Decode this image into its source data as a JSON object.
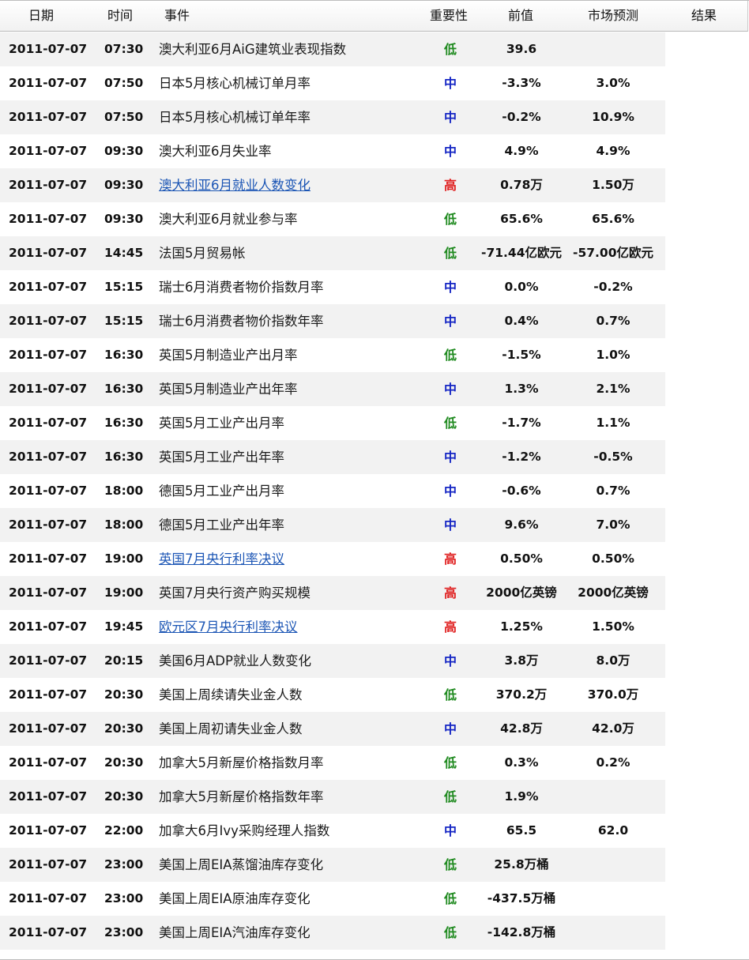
{
  "columns": [
    "日期",
    "时间",
    "事件",
    "重要性",
    "前值",
    "市场预测",
    "结果"
  ],
  "importance_colors": {
    "低": "#1f8a1f",
    "中": "#1526c4",
    "高": "#e02020"
  },
  "link_color": "#1c56b5",
  "rows": [
    {
      "date": "2011-07-07",
      "time": "07:30",
      "event": "澳大利亚6月AiG建筑业表现指数",
      "link": false,
      "importance": "低",
      "previous": "39.6",
      "forecast": "",
      "result": ""
    },
    {
      "date": "2011-07-07",
      "time": "07:50",
      "event": "日本5月核心机械订单月率",
      "link": false,
      "importance": "中",
      "previous": "-3.3%",
      "forecast": "3.0%",
      "result": ""
    },
    {
      "date": "2011-07-07",
      "time": "07:50",
      "event": "日本5月核心机械订单年率",
      "link": false,
      "importance": "中",
      "previous": "-0.2%",
      "forecast": "10.9%",
      "result": ""
    },
    {
      "date": "2011-07-07",
      "time": "09:30",
      "event": "澳大利亚6月失业率",
      "link": false,
      "importance": "中",
      "previous": "4.9%",
      "forecast": "4.9%",
      "result": ""
    },
    {
      "date": "2011-07-07",
      "time": "09:30",
      "event": "澳大利亚6月就业人数变化",
      "link": true,
      "importance": "高",
      "previous": "0.78万",
      "forecast": "1.50万",
      "result": ""
    },
    {
      "date": "2011-07-07",
      "time": "09:30",
      "event": "澳大利亚6月就业参与率",
      "link": false,
      "importance": "低",
      "previous": "65.6%",
      "forecast": "65.6%",
      "result": ""
    },
    {
      "date": "2011-07-07",
      "time": "14:45",
      "event": "法国5月贸易帐",
      "link": false,
      "importance": "低",
      "previous": "-71.44亿欧元",
      "forecast": "-57.00亿欧元",
      "result": ""
    },
    {
      "date": "2011-07-07",
      "time": "15:15",
      "event": "瑞士6月消费者物价指数月率",
      "link": false,
      "importance": "中",
      "previous": "0.0%",
      "forecast": "-0.2%",
      "result": ""
    },
    {
      "date": "2011-07-07",
      "time": "15:15",
      "event": "瑞士6月消费者物价指数年率",
      "link": false,
      "importance": "中",
      "previous": "0.4%",
      "forecast": "0.7%",
      "result": ""
    },
    {
      "date": "2011-07-07",
      "time": "16:30",
      "event": "英国5月制造业产出月率",
      "link": false,
      "importance": "低",
      "previous": "-1.5%",
      "forecast": "1.0%",
      "result": ""
    },
    {
      "date": "2011-07-07",
      "time": "16:30",
      "event": "英国5月制造业产出年率",
      "link": false,
      "importance": "中",
      "previous": "1.3%",
      "forecast": "2.1%",
      "result": ""
    },
    {
      "date": "2011-07-07",
      "time": "16:30",
      "event": "英国5月工业产出月率",
      "link": false,
      "importance": "低",
      "previous": "-1.7%",
      "forecast": "1.1%",
      "result": ""
    },
    {
      "date": "2011-07-07",
      "time": "16:30",
      "event": "英国5月工业产出年率",
      "link": false,
      "importance": "中",
      "previous": "-1.2%",
      "forecast": "-0.5%",
      "result": ""
    },
    {
      "date": "2011-07-07",
      "time": "18:00",
      "event": "德国5月工业产出月率",
      "link": false,
      "importance": "中",
      "previous": "-0.6%",
      "forecast": "0.7%",
      "result": ""
    },
    {
      "date": "2011-07-07",
      "time": "18:00",
      "event": "德国5月工业产出年率",
      "link": false,
      "importance": "中",
      "previous": "9.6%",
      "forecast": "7.0%",
      "result": ""
    },
    {
      "date": "2011-07-07",
      "time": "19:00",
      "event": "英国7月央行利率决议",
      "link": true,
      "importance": "高",
      "previous": "0.50%",
      "forecast": "0.50%",
      "result": ""
    },
    {
      "date": "2011-07-07",
      "time": "19:00",
      "event": "英国7月央行资产购买规模",
      "link": false,
      "importance": "高",
      "previous": "2000亿英镑",
      "forecast": "2000亿英镑",
      "result": ""
    },
    {
      "date": "2011-07-07",
      "time": "19:45",
      "event": "欧元区7月央行利率决议",
      "link": true,
      "importance": "高",
      "previous": "1.25%",
      "forecast": "1.50%",
      "result": ""
    },
    {
      "date": "2011-07-07",
      "time": "20:15",
      "event": "美国6月ADP就业人数变化",
      "link": false,
      "importance": "中",
      "previous": "3.8万",
      "forecast": "8.0万",
      "result": ""
    },
    {
      "date": "2011-07-07",
      "time": "20:30",
      "event": "美国上周续请失业金人数",
      "link": false,
      "importance": "低",
      "previous": "370.2万",
      "forecast": "370.0万",
      "result": ""
    },
    {
      "date": "2011-07-07",
      "time": "20:30",
      "event": "美国上周初请失业金人数",
      "link": false,
      "importance": "中",
      "previous": "42.8万",
      "forecast": "42.0万",
      "result": ""
    },
    {
      "date": "2011-07-07",
      "time": "20:30",
      "event": "加拿大5月新屋价格指数月率",
      "link": false,
      "importance": "低",
      "previous": "0.3%",
      "forecast": "0.2%",
      "result": ""
    },
    {
      "date": "2011-07-07",
      "time": "20:30",
      "event": "加拿大5月新屋价格指数年率",
      "link": false,
      "importance": "低",
      "previous": "1.9%",
      "forecast": "",
      "result": ""
    },
    {
      "date": "2011-07-07",
      "time": "22:00",
      "event": "加拿大6月Ivy采购经理人指数",
      "link": false,
      "importance": "中",
      "previous": "65.5",
      "forecast": "62.0",
      "result": ""
    },
    {
      "date": "2011-07-07",
      "time": "23:00",
      "event": "美国上周EIA蒸馏油库存变化",
      "link": false,
      "importance": "低",
      "previous": "25.8万桶",
      "forecast": "",
      "result": ""
    },
    {
      "date": "2011-07-07",
      "time": "23:00",
      "event": "美国上周EIA原油库存变化",
      "link": false,
      "importance": "低",
      "previous": "-437.5万桶",
      "forecast": "",
      "result": ""
    },
    {
      "date": "2011-07-07",
      "time": "23:00",
      "event": "美国上周EIA汽油库存变化",
      "link": false,
      "importance": "低",
      "previous": "-142.8万桶",
      "forecast": "",
      "result": ""
    }
  ]
}
